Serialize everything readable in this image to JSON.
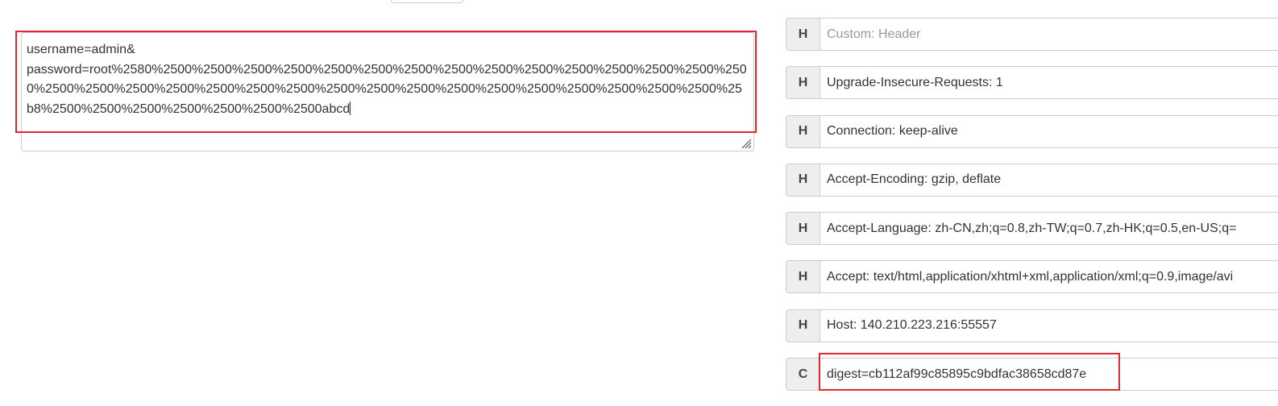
{
  "request_body": {
    "value": "username=admin&\npassword=root%2580%2500%2500%2500%2500%2500%2500%2500%2500%2500%2500%2500%2500%2500%2500%2500%2500%2500%2500%2500%2500%2500%2500%2500%2500%2500%2500%2500%2500%2500%2500%2500%2500%25b8%2500%2500%2500%2500%2500%2500%2500abcd"
  },
  "headers": [
    {
      "type": "H",
      "value": "",
      "placeholder": "Custom: Header"
    },
    {
      "type": "H",
      "value": "Upgrade-Insecure-Requests: 1",
      "placeholder": ""
    },
    {
      "type": "H",
      "value": "Connection: keep-alive",
      "placeholder": ""
    },
    {
      "type": "H",
      "value": "Accept-Encoding: gzip, deflate",
      "placeholder": ""
    },
    {
      "type": "H",
      "value": "Accept-Language: zh-CN,zh;q=0.8,zh-TW;q=0.7,zh-HK;q=0.5,en-US;q=",
      "placeholder": ""
    },
    {
      "type": "H",
      "value": "Accept: text/html,application/xhtml+xml,application/xml;q=0.9,image/avi",
      "placeholder": ""
    },
    {
      "type": "H",
      "value": "Host: 140.210.223.216:55557",
      "placeholder": ""
    },
    {
      "type": "C",
      "value": "digest=cb112af99c85895c9bdfac38658cd87e",
      "placeholder": ""
    }
  ],
  "colors": {
    "highlight": "#e0282e",
    "border": "#cccccc",
    "type_bg": "#eeeeee"
  }
}
